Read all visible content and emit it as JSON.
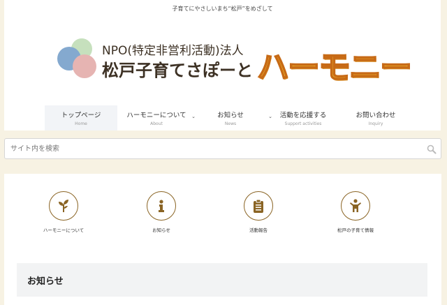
{
  "header": {
    "tagline": "子育てにやさしいまち“松戸”をめざして",
    "logo": {
      "line1": "NPO(特定非営利活動)法人",
      "line2": "松戸子育てさぽーと",
      "harmony": "ハーモニー"
    }
  },
  "nav": {
    "items": [
      {
        "label": "トップページ",
        "sub": "Home",
        "active": true
      },
      {
        "label": "ハーモニーについて",
        "sub": "About",
        "has_dropdown": true
      },
      {
        "label": "お知らせ",
        "sub": "News",
        "has_dropdown": true
      },
      {
        "label": "活動を応援する",
        "sub": "Support activities"
      },
      {
        "label": "お問い合わせ",
        "sub": "Inquiry"
      }
    ]
  },
  "search": {
    "placeholder": "サイト内を検索",
    "icon": "search-icon"
  },
  "quick_links": [
    {
      "label": "ハーモニーについて",
      "icon": "sprout-icon"
    },
    {
      "label": "お知らせ",
      "icon": "info-icon"
    },
    {
      "label": "活動報告",
      "icon": "clipboard-icon"
    },
    {
      "label": "松戸の子育て情報",
      "icon": "person-icon"
    }
  ],
  "news_section": {
    "title": "お知らせ"
  },
  "colors": {
    "background": "#f7f2e3",
    "icon_accent": "#8a6424",
    "logo_orange": "#f5c52e"
  }
}
